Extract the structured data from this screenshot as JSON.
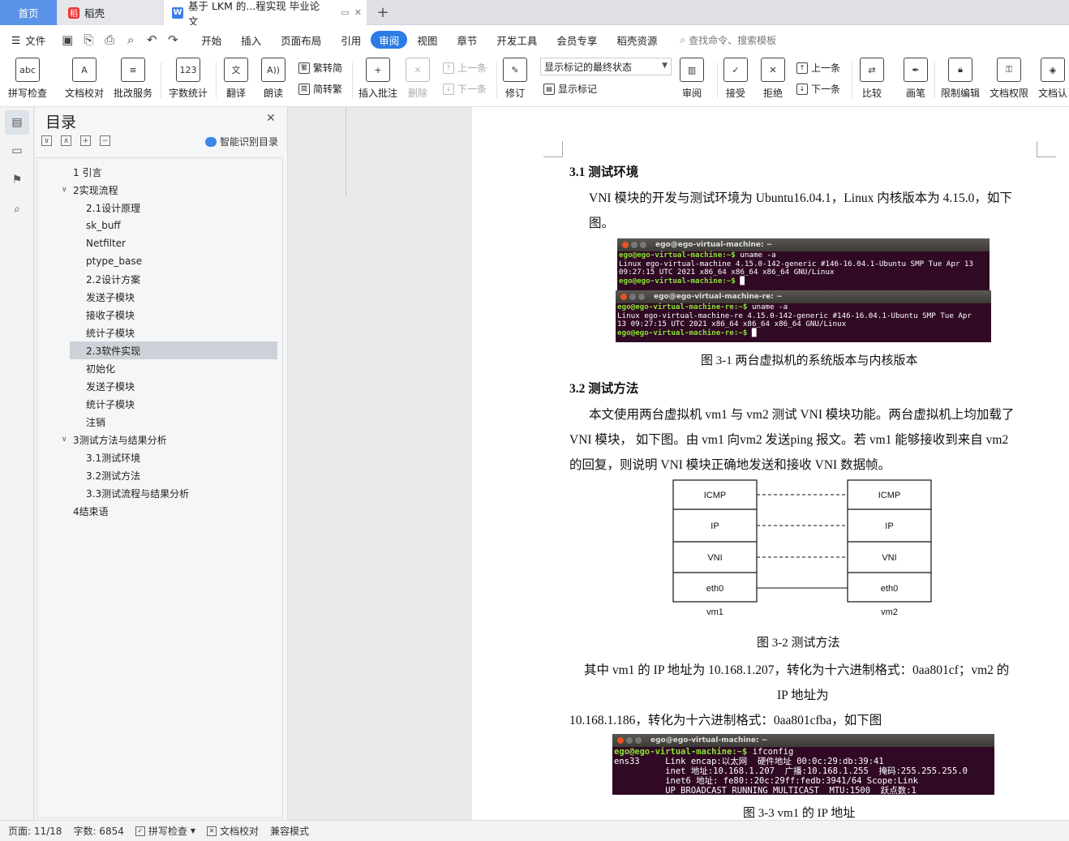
{
  "tabs": {
    "home": "首页",
    "daoke": "稻壳",
    "doc": "基于 LKM 的...程实现 毕业论文",
    "add": "+"
  },
  "menubar": {
    "file": "文件",
    "items": [
      "开始",
      "插入",
      "页面布局",
      "引用",
      "审阅",
      "视图",
      "章节",
      "开发工具",
      "会员专享",
      "稻壳资源"
    ],
    "active_index": 4,
    "search": "查找命令、搜索模板"
  },
  "ribbon": {
    "spell": "拼写检查",
    "proofread": "文档校对",
    "revise_service": "批改服务",
    "word_count": "字数统计",
    "translate": "翻译",
    "read": "朗读",
    "trad_to_simp": "繁转简",
    "simp_to_trad": "简转繁",
    "insert_comment": "插入批注",
    "delete": "删除",
    "prev": "上一条",
    "next": "下一条",
    "track": "修订",
    "show_mode": "显示标记的最终状态",
    "show_marks": "显示标记",
    "review": "审阅",
    "accept": "接受",
    "reject": "拒绝",
    "prev2": "上一条",
    "next2": "下一条",
    "compare": "比较",
    "pen": "画笔",
    "restrict": "限制编辑",
    "permission": "文档权限",
    "certify": "文档认"
  },
  "toc": {
    "title": "目录",
    "smart": "智能识别目录",
    "items": [
      {
        "label": "1 引言",
        "level": 1,
        "arrow": ""
      },
      {
        "label": "2实现流程",
        "level": 1,
        "arrow": "∨"
      },
      {
        "label": "2.1设计原理",
        "level": 2,
        "arrow": ""
      },
      {
        "label": "sk_buff",
        "level": 2,
        "arrow": ""
      },
      {
        "label": "Netfilter",
        "level": 2,
        "arrow": ""
      },
      {
        "label": "ptype_base",
        "level": 2,
        "arrow": ""
      },
      {
        "label": "2.2设计方案",
        "level": 2,
        "arrow": ""
      },
      {
        "label": "发送子模块",
        "level": 2,
        "arrow": ""
      },
      {
        "label": "接收子模块",
        "level": 2,
        "arrow": ""
      },
      {
        "label": "统计子模块",
        "level": 2,
        "arrow": ""
      },
      {
        "label": "2.3软件实现",
        "level": 2,
        "arrow": ""
      },
      {
        "label": "初始化",
        "level": 2,
        "arrow": ""
      },
      {
        "label": "发送子模块",
        "level": 2,
        "arrow": ""
      },
      {
        "label": "统计子模块",
        "level": 2,
        "arrow": ""
      },
      {
        "label": "注销",
        "level": 2,
        "arrow": ""
      },
      {
        "label": "3测试方法与结果分析",
        "level": 1,
        "arrow": "∨"
      },
      {
        "label": "3.1测试环境",
        "level": 2,
        "arrow": ""
      },
      {
        "label": "3.2测试方法",
        "level": 2,
        "arrow": ""
      },
      {
        "label": "3.3测试流程与结果分析",
        "level": 2,
        "arrow": ""
      },
      {
        "label": "4结束语",
        "level": 1,
        "arrow": ""
      }
    ],
    "selected_index": 10
  },
  "doc": {
    "h31": "3.1 测试环境",
    "p1a": "VNI 模块的开发与测试环境为 Ubuntu16.04.1，Linux 内核版本为 4.15.0，如下",
    "p1b": "图。",
    "term1": {
      "title": "ego@ego-virtual-machine: ~",
      "prompt": "ego@ego-virtual-machine:~$",
      "cmd": " uname -a",
      "out1": "Linux ego-virtual-machine 4.15.0-142-generic #146-16.04.1-Ubuntu SMP Tue Apr 13",
      "out2": "09:27:15 UTC 2021 x86_64 x86_64 x86_64 GNU/Linux"
    },
    "term2": {
      "title": "ego@ego-virtual-machine-re: ~",
      "prompt": "ego@ego-virtual-machine-re:~$",
      "cmd": " uname -a",
      "out1": "Linux ego-virtual-machine-re 4.15.0-142-generic #146-16.04.1-Ubuntu SMP Tue Apr",
      "out2": "13 09:27:15 UTC 2021 x86_64 x86_64 x86_64 GNU/Linux"
    },
    "cap1": "图 3-1 两台虚拟机的系统版本与内核版本",
    "h32": "3.2 测试方法",
    "p2a": "本文使用两台虚拟机 vm1 与 vm2 测试 VNI 模块功能。两台虚拟机上均加载了",
    "p2b": "VNI 模块， 如下图。由 vm1 向vm2 发送ping 报文。若 vm1 能够接收到来自 vm2",
    "p2c": "的回复，则说明 VNI 模块正确地发送和接收 VNI 数据帧。",
    "diagram": {
      "layers": [
        "ICMP",
        "IP",
        "VNI",
        "eth0"
      ],
      "left": "vm1",
      "right": "vm2"
    },
    "cap2": "图 3-2  测试方法",
    "p3a": "其中 vm1 的 IP 地址为 10.168.1.207，转化为十六进制格式：0aa801cf；vm2 的",
    "p3b": "IP 地址为",
    "p3c": "10.168.1.186，转化为十六进制格式：0aa801cfba，如下图",
    "term3": {
      "title": "ego@ego-virtual-machine: ~",
      "prompt": "ego@ego-virtual-machine:~$",
      "cmd": " ifconfig",
      "out1": "ens33     Link encap:以太网  硬件地址 00:0c:29:db:39:41",
      "out2": "          inet 地址:10.168.1.207  广播:10.168.1.255  掩码:255.255.255.0",
      "out3": "          inet6 地址: fe80::20c:29ff:fedb:3941/64 Scope:Link",
      "out4": "          UP BROADCAST RUNNING MULTICAST  MTU:1500  跃点数:1"
    },
    "cap3": "图 3-3 vm1 的 IP 地址"
  },
  "status": {
    "page": "页面: 11/18",
    "words": "字数: 6854",
    "spell": "拼写检查",
    "proof": "文档校对",
    "compat": "兼容模式"
  },
  "colors": {
    "accent": "#2d7be5",
    "home_tab": "#5b93e8",
    "terminal_bg": "#300a24"
  }
}
